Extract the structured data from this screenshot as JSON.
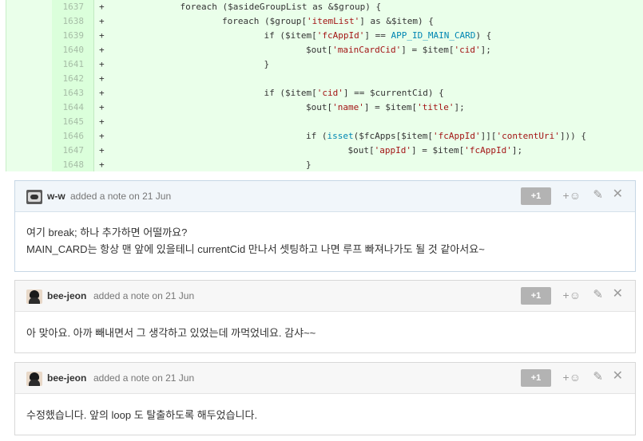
{
  "diff": {
    "lines": [
      {
        "num": "1637",
        "sign": "+",
        "indent": 13,
        "code": "foreach ($asideGroupList as &$group) {"
      },
      {
        "num": "1638",
        "sign": "+",
        "indent": 20,
        "code": "foreach ($group['itemList'] as &$item) {"
      },
      {
        "num": "1639",
        "sign": "+",
        "indent": 27,
        "code": "if ($item['fcAppId'] == APP_ID_MAIN_CARD) {"
      },
      {
        "num": "1640",
        "sign": "+",
        "indent": 34,
        "code": "$out['mainCardCid'] = $item['cid'];"
      },
      {
        "num": "1641",
        "sign": "+",
        "indent": 27,
        "code": "}"
      },
      {
        "num": "1642",
        "sign": "+",
        "indent": 0,
        "code": ""
      },
      {
        "num": "1643",
        "sign": "+",
        "indent": 27,
        "code": "if ($item['cid'] == $currentCid) {"
      },
      {
        "num": "1644",
        "sign": "+",
        "indent": 34,
        "code": "$out['name'] = $item['title'];"
      },
      {
        "num": "1645",
        "sign": "+",
        "indent": 0,
        "code": ""
      },
      {
        "num": "1646",
        "sign": "+",
        "indent": 34,
        "code": "if (isset($fcApps[$item['fcAppId']]['contentUri'])) {"
      },
      {
        "num": "1647",
        "sign": "+",
        "indent": 41,
        "code": "$out['appId'] = $item['fcAppId'];"
      },
      {
        "num": "1648",
        "sign": "+",
        "indent": 34,
        "code": "}"
      }
    ]
  },
  "notes": [
    {
      "author": "w-w",
      "meta": "added a note on 21 Jun",
      "plus_one": "+1",
      "body": [
        "여기 break; 하나 추가하면 어떨까요?",
        "MAIN_CARD는 항상 맨 앞에 있을테니 currentCid 만나서 셋팅하고 나면 루프 빠져나가도 될 것 같아서요~"
      ],
      "avatar_icon": "avatar-dark-icon"
    },
    {
      "author": "bee-jeon",
      "meta": "added a note on 21 Jun",
      "plus_one": "+1",
      "body": [
        "아 맞아요. 아까 빼내면서 그 생각하고 있었는데 까먹었네요. 감샤~~"
      ],
      "avatar_icon": "avatar-photo-icon"
    },
    {
      "author": "bee-jeon",
      "meta": "added a note on 21 Jun",
      "plus_one": "+1",
      "body": [
        "수정했습니다. 앞의 loop 도 탈출하도록 해두었습니다."
      ],
      "avatar_icon": "avatar-photo-icon"
    }
  ],
  "icons": {
    "react": "add-emoji-icon",
    "edit": "pencil-icon",
    "close": "close-icon"
  },
  "colors": {
    "diff_bg": "#eaffea",
    "gutter_bg": "#dbffdb",
    "plus_one_bg": "#b3b3b3"
  }
}
